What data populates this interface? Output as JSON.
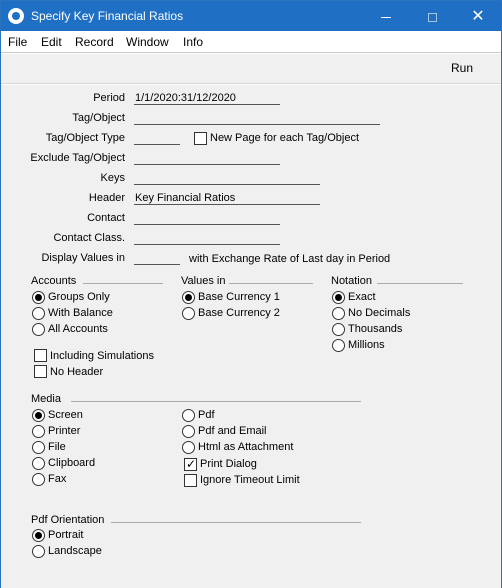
{
  "window": {
    "title": "Specify Key Financial Ratios"
  },
  "menu": [
    "File",
    "Edit",
    "Record",
    "Window",
    "Info"
  ],
  "toolbar": {
    "run_label": "Run"
  },
  "fields": {
    "period": {
      "label": "Period",
      "value": "1/1/2020:31/12/2020"
    },
    "tag_object": {
      "label": "Tag/Object",
      "value": ""
    },
    "tag_object_type": {
      "label": "Tag/Object Type",
      "value": ""
    },
    "new_page": {
      "label": "New Page for each Tag/Object",
      "checked": false
    },
    "exclude_tag_object": {
      "label": "Exclude Tag/Object",
      "value": ""
    },
    "keys": {
      "label": "Keys",
      "value": ""
    },
    "header": {
      "label": "Header",
      "value": "Key Financial Ratios"
    },
    "contact": {
      "label": "Contact",
      "value": ""
    },
    "contact_class": {
      "label": "Contact Class.",
      "value": ""
    },
    "display_values_in": {
      "label": "Display Values in",
      "value": "",
      "suffix": "with Exchange Rate of Last day in Period"
    }
  },
  "groups": {
    "accounts": {
      "title": "Accounts",
      "options": [
        "Groups Only",
        "With Balance",
        "All Accounts"
      ],
      "selected": 0
    },
    "values_in": {
      "title": "Values in",
      "options": [
        "Base Currency 1",
        "Base Currency 2"
      ],
      "selected": 0
    },
    "notation": {
      "title": "Notation",
      "options": [
        "Exact",
        "No Decimals",
        "Thousands",
        "Millions"
      ],
      "selected": 0
    },
    "media": {
      "title": "Media",
      "options": [
        "Screen",
        "Printer",
        "File",
        "Clipboard",
        "Fax",
        "Pdf",
        "Pdf and Email",
        "Html as Attachment"
      ],
      "selected": 0
    },
    "pdf_orientation": {
      "title": "Pdf Orientation",
      "options": [
        "Portrait",
        "Landscape"
      ],
      "selected": 0
    }
  },
  "checkboxes": {
    "including_simulations": {
      "label": "Including Simulations",
      "checked": false
    },
    "no_header": {
      "label": "No Header",
      "checked": false
    },
    "print_dialog": {
      "label": "Print Dialog",
      "checked": true
    },
    "ignore_timeout": {
      "label": "Ignore Timeout Limit",
      "checked": false
    }
  },
  "colors": {
    "titlebar": "#1f6fc4",
    "background": "#f0f0f0"
  }
}
